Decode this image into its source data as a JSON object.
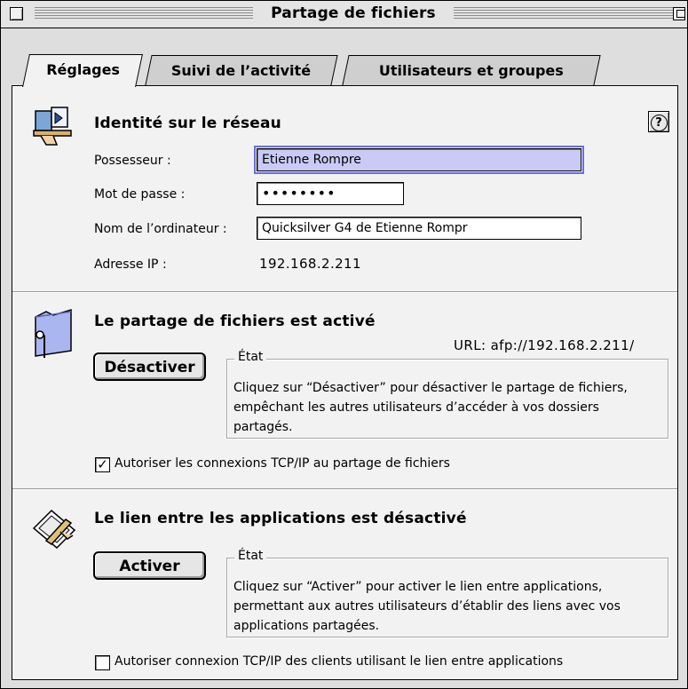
{
  "window": {
    "title": "Partage de fichiers"
  },
  "tabs": [
    {
      "label": "Réglages",
      "active": true
    },
    {
      "label": "Suivi de l’activité",
      "active": false
    },
    {
      "label": "Utilisateurs et groupes",
      "active": false
    }
  ],
  "identity": {
    "heading": "Identité sur le réseau",
    "help_label": "?",
    "owner_label": "Possesseur :",
    "owner_value": "Etienne Rompre",
    "password_label": "Mot de passe :",
    "password_value": "••••••••",
    "computer_label": "Nom de l’ordinateur :",
    "computer_value": "Quicksilver G4 de Etienne Rompr",
    "ip_label": "Adresse IP :",
    "ip_value": "192.168.2.211"
  },
  "file_sharing": {
    "heading": "Le partage de fichiers est activé",
    "url": "URL: afp://192.168.2.211/",
    "button_label": "Désactiver",
    "status_title": "État",
    "status_text": "Cliquez sur “Désactiver” pour désactiver le partage de fichiers, empêchant les autres utilisateurs d’accéder à vos dossiers partagés.",
    "tcp_checkbox_label": "Autoriser les connexions TCP/IP au partage de fichiers",
    "tcp_checked": true,
    "check_glyph": "✓"
  },
  "program_linking": {
    "heading": "Le lien entre les applications est désactivé",
    "button_label": "Activer",
    "status_title": "État",
    "status_text": "Cliquez sur “Activer” pour activer le lien entre applications, permettant aux autres utilisateurs d’établir des liens avec vos applications partagées.",
    "tcp_checkbox_label": "Autoriser connexion TCP/IP des clients utilisant le lien entre applications",
    "tcp_checked": false
  },
  "icons": {
    "identity": "network-identity-icon",
    "sharing": "shared-folder-icon",
    "linking": "program-linking-icon",
    "close": "close-box-icon",
    "zoom": "zoom-box-icon"
  }
}
